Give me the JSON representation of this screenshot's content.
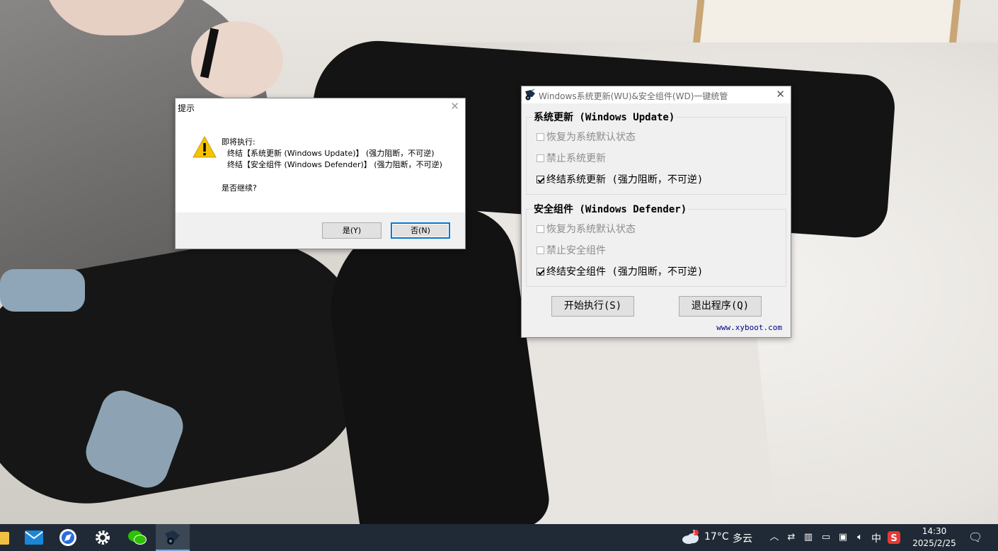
{
  "prompt_dialog": {
    "title": "提示",
    "close_glyph": "✕",
    "icon": "warning-icon",
    "intro": "即将执行:",
    "line1": "终结【系统更新 (Windows Update)】 (强力阻断，不可逆)",
    "line2": "终结【安全组件 (Windows Defender)】 (强力阻断，不可逆)",
    "question": "是否继续?",
    "yes_label": "是(Y)",
    "no_label": "否(N)"
  },
  "tool_window": {
    "title": "Windows系统更新(WU)&安全组件(WD)一键统管",
    "close_glyph": "✕",
    "group_update": {
      "legend": "系统更新 (Windows Update)",
      "options": [
        {
          "label": "恢复为系统默认状态",
          "checked": false,
          "enabled": false
        },
        {
          "label": "禁止系统更新",
          "checked": false,
          "enabled": false
        },
        {
          "label": "终结系统更新 (强力阻断，不可逆)",
          "checked": true,
          "enabled": true
        }
      ]
    },
    "group_defender": {
      "legend": "安全组件 (Windows Defender)",
      "options": [
        {
          "label": "恢复为系统默认状态",
          "checked": false,
          "enabled": false
        },
        {
          "label": "禁止安全组件",
          "checked": false,
          "enabled": false
        },
        {
          "label": "终结安全组件 (强力阻断，不可逆)",
          "checked": true,
          "enabled": true
        }
      ]
    },
    "start_label": "开始执行(S)",
    "exit_label": "退出程序(Q)",
    "website": "www.xyboot.com"
  },
  "taskbar": {
    "apps": [
      "file-explorer-icon",
      "mail-icon",
      "browser-icon",
      "settings-icon",
      "wechat-icon",
      "xyboot-tool-icon"
    ],
    "weather": {
      "temp": "17°C",
      "condition": "多云",
      "badge": "1"
    },
    "ime": "中",
    "clock": {
      "time": "14:30",
      "date": "2025/2/25"
    },
    "accent": "#0078d7"
  }
}
